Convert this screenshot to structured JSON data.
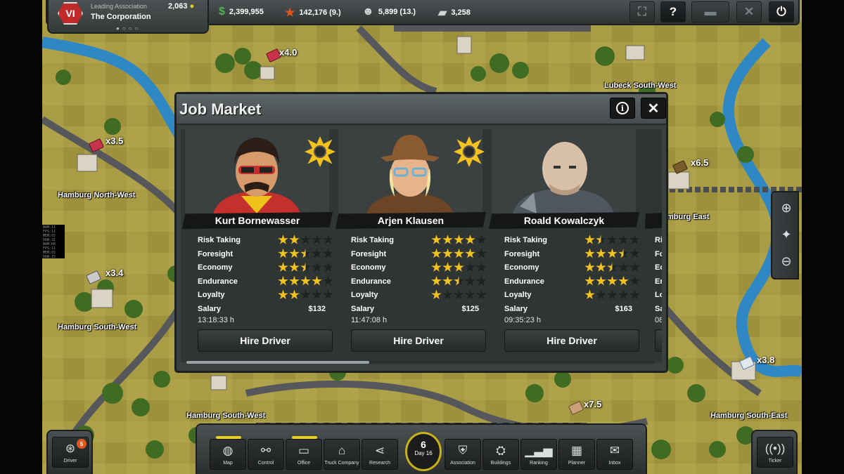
{
  "association": {
    "subtitle": "Leading Association",
    "name": "The Corporation",
    "logo_text": "VI",
    "points": "2,063"
  },
  "stats": {
    "money": "2,399,955",
    "reputation": "142,176 (9.)",
    "staff": "5,899 (13.)",
    "trucks": "3,258"
  },
  "top_buttons": {
    "fullscreen_icon": "fullscreen-icon",
    "help_label": "?",
    "truck_icon": "truck-icon",
    "tools_icon": "tools-icon",
    "power_icon": "power-icon"
  },
  "map": {
    "cities": [
      {
        "name": "Lubeck South-West",
        "mult": ""
      },
      {
        "name": "Hamburg North-West",
        "mult": "x3.5"
      },
      {
        "name": "Hamburg South-West",
        "mult": "x3.4"
      },
      {
        "name": "Hamburg South-West",
        "mult": ""
      },
      {
        "name": "mburg East",
        "mult": "x6.5"
      },
      {
        "name": "Hamburg South-East",
        "mult": "x3.8"
      }
    ],
    "extra_mults": [
      "x4.0",
      "x7.5"
    ]
  },
  "dialog": {
    "title": "Job Market",
    "info_icon": "i",
    "close_icon": "✕"
  },
  "drivers": [
    {
      "name": "Kurt Bornewasser",
      "featured": true,
      "stats": [
        {
          "label": "Risk Taking",
          "rating": 2
        },
        {
          "label": "Foresight",
          "rating": 2.5
        },
        {
          "label": "Economy",
          "rating": 2.5
        },
        {
          "label": "Endurance",
          "rating": 4
        },
        {
          "label": "Loyalty",
          "rating": 2
        }
      ],
      "salary_label": "Salary",
      "salary": "$132",
      "timer": "13:18:33 h",
      "hire_label": "Hire Driver"
    },
    {
      "name": "Arjen Klausen",
      "featured": true,
      "stats": [
        {
          "label": "Risk Taking",
          "rating": 4
        },
        {
          "label": "Foresight",
          "rating": 4
        },
        {
          "label": "Economy",
          "rating": 3
        },
        {
          "label": "Endurance",
          "rating": 2.5
        },
        {
          "label": "Loyalty",
          "rating": 1
        }
      ],
      "salary_label": "Salary",
      "salary": "$125",
      "timer": "11:47:08 h",
      "hire_label": "Hire Driver"
    },
    {
      "name": "Roald Kowalczyk",
      "featured": false,
      "stats": [
        {
          "label": "Risk Taking",
          "rating": 1.5
        },
        {
          "label": "Foresight",
          "rating": 3.5
        },
        {
          "label": "Economy",
          "rating": 2.5
        },
        {
          "label": "Endurance",
          "rating": 4
        },
        {
          "label": "Loyalty",
          "rating": 1
        }
      ],
      "salary_label": "Salary",
      "salary": "$163",
      "timer": "09:35:23 h",
      "hire_label": "Hire Driver"
    }
  ],
  "partial_card": {
    "labels": [
      "Ri",
      "Fo",
      "Ec",
      "En",
      "Lo",
      "Sa"
    ],
    "timer": "08"
  },
  "scroll_position": 0.39,
  "bottom_nav": {
    "items": [
      {
        "label": "Map",
        "icon": "globe-icon",
        "active": true
      },
      {
        "label": "Control",
        "icon": "control-icon",
        "active": false
      },
      {
        "label": "Office",
        "icon": "office-icon",
        "active": true
      },
      {
        "label": "Truck Company",
        "icon": "truck-company-icon",
        "active": false
      },
      {
        "label": "Research",
        "icon": "research-icon",
        "active": false
      },
      {
        "label": "Association",
        "icon": "association-icon",
        "active": false
      },
      {
        "label": "Buildings",
        "icon": "buildings-icon",
        "active": false
      },
      {
        "label": "Ranking",
        "icon": "ranking-icon",
        "active": false
      },
      {
        "label": "Planner",
        "icon": "planner-icon",
        "active": false
      },
      {
        "label": "Inbox",
        "icon": "inbox-icon",
        "active": false
      }
    ],
    "day_number": "6",
    "day_label": "Day 16",
    "driver_label": "Driver",
    "driver_count": "5",
    "ticker_label": "Ticker"
  },
  "colors": {
    "star_full": "#f4c21c",
    "star_empty": "#1e2122",
    "accent_yellow": "#e8d21c",
    "badge": "#f4c21c"
  }
}
